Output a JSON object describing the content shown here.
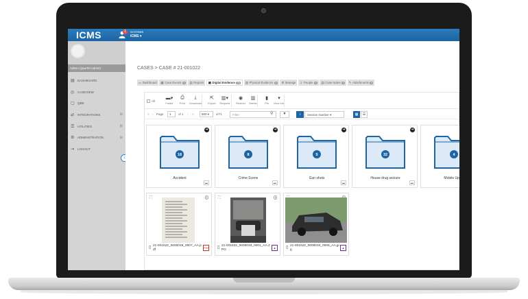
{
  "app": {
    "logo": "ICMS",
    "notification_count": "1",
    "system_label": "SYSTEMS",
    "system_name": "ICMS ▾"
  },
  "sidebar": {
    "user": "Admin (QueTel Admin)",
    "items": [
      {
        "label": "DASHBOARD",
        "icon": "dashboard-icon",
        "glyph": "▤",
        "expandable": false
      },
      {
        "label": "CASEVIEW",
        "icon": "globe-icon",
        "glyph": "◎",
        "expandable": false
      },
      {
        "label": "QBE",
        "icon": "document-icon",
        "glyph": "▢",
        "expandable": false
      },
      {
        "label": "INTEGRATIONS",
        "icon": "exchange-icon",
        "glyph": "⇄",
        "expandable": true
      },
      {
        "label": "UTILITIES",
        "icon": "sliders-icon",
        "glyph": "☰",
        "expandable": true
      },
      {
        "label": "ADMINISTRATION",
        "icon": "gear-icon",
        "glyph": "⚙",
        "expandable": true
      },
      {
        "label": "LOGOUT",
        "icon": "logout-icon",
        "glyph": "⇥",
        "expandable": false
      }
    ]
  },
  "breadcrumb": "CASES > CASE # 21-001022",
  "tabs": [
    {
      "label": "Dashboard",
      "count": "",
      "active": false,
      "glyph": "▭"
    },
    {
      "label": "Case Events",
      "count": "1",
      "active": false,
      "glyph": "▦"
    },
    {
      "label": "Reports",
      "count": "",
      "active": false,
      "glyph": "▤"
    },
    {
      "label": "Digital Evidence",
      "count": "71",
      "active": true,
      "glyph": "▣"
    },
    {
      "label": "Physical Evidence",
      "count": "0",
      "active": false,
      "glyph": "▥"
    },
    {
      "label": "Manage",
      "count": "",
      "active": false,
      "glyph": "⚙"
    },
    {
      "label": "People",
      "count": "4",
      "active": false,
      "glyph": "☺"
    },
    {
      "label": "Case Notes",
      "count": "0",
      "active": false,
      "glyph": "▤"
    },
    {
      "label": "Attachments",
      "count": "6",
      "active": false,
      "glyph": "✎"
    }
  ],
  "toolbar": {
    "all_label": "All",
    "buttons": [
      {
        "label": "Folder",
        "glyph": "▬▾"
      },
      {
        "label": "Print",
        "glyph": "⎙"
      },
      {
        "label": "Download",
        "glyph": "⤓"
      },
      {
        "label": "Export",
        "glyph": "⇱"
      },
      {
        "label": "Request",
        "glyph": "▥▾"
      },
      {
        "label": "Restrict",
        "glyph": "◉"
      },
      {
        "label": "Delete",
        "glyph": "▥"
      },
      {
        "label": "Pin",
        "glyph": "▮"
      },
      {
        "label": "View info",
        "glyph": "▾"
      }
    ]
  },
  "pager": {
    "page_label": "Page",
    "page_value": "1",
    "of_label": "of 1",
    "per_page": "500 ▾",
    "count": "4/71",
    "filter_placeholder": "Filter",
    "sort_field": "Session Number ▾"
  },
  "folders": [
    {
      "name": "Accident",
      "count": "18"
    },
    {
      "name": "Crime Scene",
      "count": "8"
    },
    {
      "name": "Gun shots",
      "count": "5"
    },
    {
      "name": "House drug seizure",
      "count": "32"
    },
    {
      "name": "Mobile Uploa",
      "count": "4"
    }
  ],
  "files": [
    {
      "name": "21-001022_0000019_0007_AA.pdf",
      "type": "pdf",
      "type_color": "#c0392b"
    },
    {
      "name": "21-001022_0000033_0001_AA.JPG",
      "type": "img",
      "type_color": "#6a2c91"
    },
    {
      "name": "21-001022_0000034_0005_AA.jpg",
      "type": "img",
      "type_color": "#6a2c91"
    }
  ],
  "colors": {
    "topbar": "#1e64a3",
    "folder_fill": "#dbeaf6",
    "folder_stroke": "#1e64a3"
  }
}
